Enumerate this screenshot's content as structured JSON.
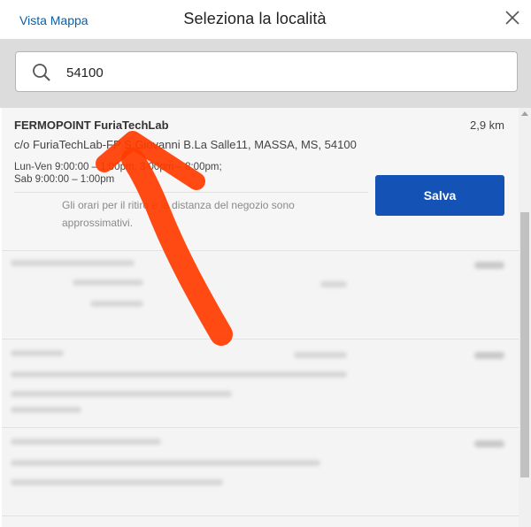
{
  "header": {
    "map_link": "Vista Mappa",
    "title": "Seleziona la località",
    "close_icon": "close-icon"
  },
  "search": {
    "value": "54100",
    "icon": "search-icon"
  },
  "results": [
    {
      "name": "FERMOPOINT FuriaTechLab",
      "distance": "2,9 km",
      "address": "c/o FuriaTechLab-FP S.Giovanni B.La Salle11, MASSA, MS, 54100",
      "hours_weekday": "Lun-Ven 9:00:00 – 1:00pm, 3:00pm – 8:00pm;",
      "hours_saturday": "Sab 9:00:00 – 1:00pm",
      "note": "Gli orari per il ritiro e la distanza del negozio sono approssimativi.",
      "save_label": "Salva"
    }
  ],
  "colors": {
    "accent": "#1453b5",
    "link": "#0a5fa8",
    "annotation": "#ff3b00"
  }
}
